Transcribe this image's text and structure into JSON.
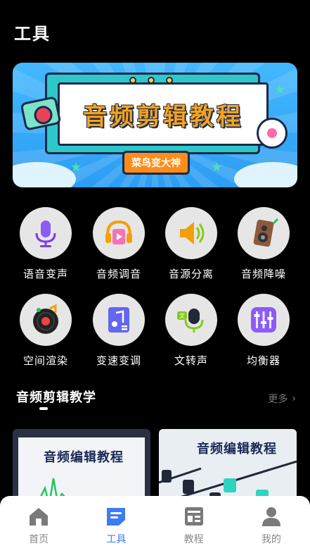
{
  "header": {
    "title": "工具"
  },
  "banner": {
    "headline": "音频剪辑教程",
    "badge": "菜鸟变大神"
  },
  "tools": [
    {
      "label": "语音变声",
      "icon": "microphone-icon"
    },
    {
      "label": "音频调音",
      "icon": "headphones-video-icon"
    },
    {
      "label": "音源分离",
      "icon": "speaker-icon"
    },
    {
      "label": "音频降噪",
      "icon": "loudspeaker-box-icon"
    },
    {
      "label": "空间渲染",
      "icon": "vinyl-record-icon"
    },
    {
      "label": "变速变调",
      "icon": "music-file-icon"
    },
    {
      "label": "文转声",
      "icon": "text-to-speech-icon"
    },
    {
      "label": "均衡器",
      "icon": "equalizer-icon"
    }
  ],
  "section": {
    "title": "音频剪辑教学",
    "more": "更多"
  },
  "cards": [
    {
      "title": "音频编辑教程"
    },
    {
      "title": "音频编辑教程"
    }
  ],
  "nav": {
    "items": [
      {
        "label": "首页",
        "icon": "home-icon"
      },
      {
        "label": "工具",
        "icon": "tools-icon"
      },
      {
        "label": "教程",
        "icon": "tutorial-icon"
      },
      {
        "label": "我的",
        "icon": "user-icon"
      }
    ],
    "active_index": 1,
    "active_color": "#3d7cf2",
    "inactive_color": "#888888"
  }
}
